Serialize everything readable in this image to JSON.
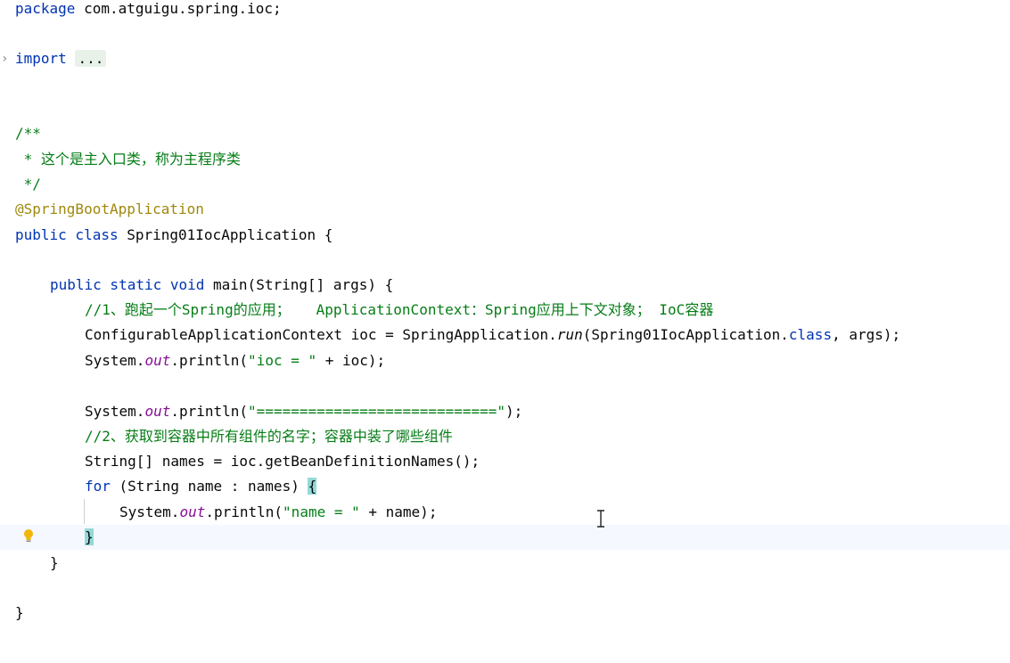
{
  "editor": {
    "lines": {
      "package_kw": "package",
      "package_name": " com.atguigu.spring.ioc;",
      "import_kw": "import",
      "import_fold": "...",
      "doc_open": "/**",
      "doc_body": " * 这个是主入口类，称为主程序类",
      "doc_close": " */",
      "annotation": "@SpringBootApplication",
      "class_kw": "public class",
      "class_rest": " Spring01IocApplication {",
      "main_kw": "public static void",
      "main_rest": " main(String[] args) {",
      "comment1": "//1、跑起一个Spring的应用；   ApplicationContext：Spring应用上下文对象； IoC容器",
      "ioc_decl_a": "ConfigurableApplicationContext ioc = SpringApplication.",
      "ioc_decl_run": "run",
      "ioc_decl_b": "(Spring01IocApplication.",
      "ioc_decl_class": "class",
      "ioc_decl_c": ", args);",
      "print1_a": "System.",
      "print1_out": "out",
      "print1_b": ".println(",
      "print1_str": "\"ioc = \"",
      "print1_c": " + ioc);",
      "print2_a": "System.",
      "print2_out": "out",
      "print2_b": ".println(",
      "print2_str": "\"============================\"",
      "print2_c": ");",
      "comment2": "//2、获取到容器中所有组件的名字；容器中装了哪些组件",
      "names_decl": "String[] names = ioc.getBeanDefinitionNames();",
      "for_kw": "for",
      "for_rest": " (String name : names) ",
      "for_brace": "{",
      "print3_a": "System.",
      "print3_out": "out",
      "print3_b": ".println(",
      "print3_str": "\"name = \"",
      "print3_c": " + name);",
      "close_for": "}",
      "close_main": "}",
      "close_class": "}"
    },
    "icons": {
      "bulb": "lightbulb-icon",
      "cursor": "text-cursor-icon",
      "fold": "chevron-right-icon"
    },
    "colors": {
      "keyword": "#0033b3",
      "comment": "#067d17",
      "annotation": "#9e880d",
      "static_field": "#871094",
      "brace_match": "#93d9d9",
      "current_line": "#f5f8fe"
    }
  }
}
